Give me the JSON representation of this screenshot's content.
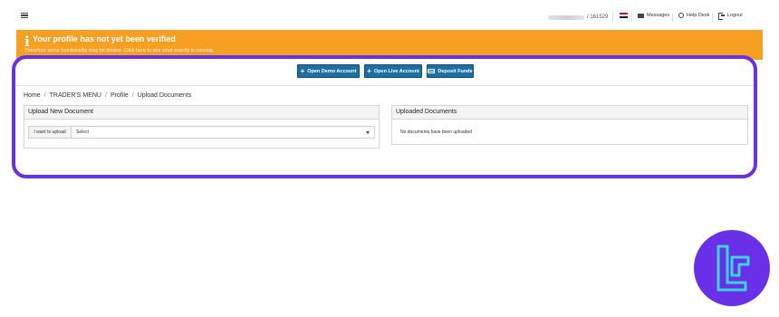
{
  "topbar": {
    "account_number": "/ 161529",
    "messages_label": "Messages",
    "helpdesk_label": "Help Desk",
    "logout_label": "Logout"
  },
  "warning": {
    "title": "Your profile has not yet been verified",
    "subtitle": "Therefore some functionality may be limited. Click here to see what exactly is missing."
  },
  "actions": {
    "demo_label": "Open Demo Account",
    "live_label": "Open Live Account",
    "deposit_label": "Deposit Funds"
  },
  "breadcrumb": [
    "Home",
    "TRADER'S MENU",
    "Profile",
    "Upload Documents"
  ],
  "upload_panel": {
    "title": "Upload New Document",
    "field_label": "I want to upload",
    "select_value": "Select"
  },
  "uploaded_panel": {
    "title": "Uploaded Documents",
    "empty_message": "No documents have been uploaded"
  },
  "colors": {
    "warning": "#f5a023",
    "button": "#1d6ea3",
    "frame_highlight": "#6a30e8"
  }
}
